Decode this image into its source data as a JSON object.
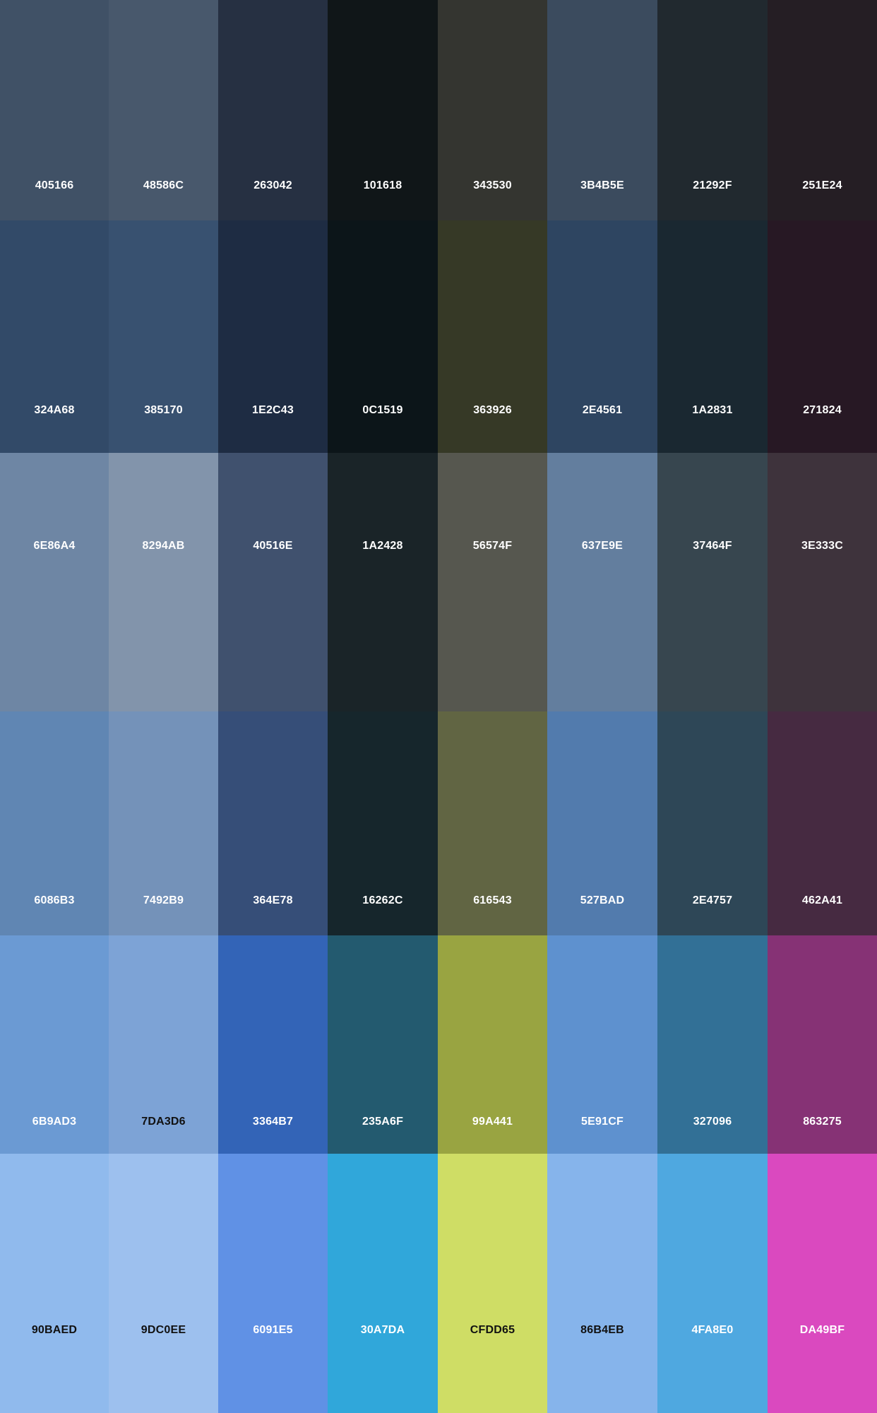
{
  "palette": {
    "rows": [
      [
        {
          "hex": "405166",
          "color": "#405166"
        },
        {
          "hex": "48586C",
          "color": "#48586C"
        },
        {
          "hex": "263042",
          "color": "#263042"
        },
        {
          "hex": "101618",
          "color": "#101618"
        },
        {
          "hex": "343530",
          "color": "#343530"
        },
        {
          "hex": "3B4B5E",
          "color": "#3B4B5E"
        },
        {
          "hex": "21292F",
          "color": "#21292F"
        },
        {
          "hex": "251E24",
          "color": "#251E24"
        }
      ],
      [
        {
          "hex": "324A68",
          "color": "#324A68"
        },
        {
          "hex": "385170",
          "color": "#385170"
        },
        {
          "hex": "1E2C43",
          "color": "#1E2C43"
        },
        {
          "hex": "0C1519",
          "color": "#0C1519"
        },
        {
          "hex": "363926",
          "color": "#363926"
        },
        {
          "hex": "2E4561",
          "color": "#2E4561"
        },
        {
          "hex": "1A2831",
          "color": "#1A2831"
        },
        {
          "hex": "271824",
          "color": "#271824"
        }
      ],
      [
        {
          "hex": "6E86A4",
          "color": "#6E86A4"
        },
        {
          "hex": "8294AB",
          "color": "#8294AB"
        },
        {
          "hex": "40516E",
          "color": "#40516E"
        },
        {
          "hex": "1A2428",
          "color": "#1A2428"
        },
        {
          "hex": "56574F",
          "color": "#56574F"
        },
        {
          "hex": "637E9E",
          "color": "#637E9E"
        },
        {
          "hex": "37464F",
          "color": "#37464F"
        },
        {
          "hex": "3E333C",
          "color": "#3E333C"
        }
      ],
      [
        {
          "hex": "6086B3",
          "color": "#6086B3"
        },
        {
          "hex": "7492B9",
          "color": "#7492B9"
        },
        {
          "hex": "364E78",
          "color": "#364E78"
        },
        {
          "hex": "16262C",
          "color": "#16262C"
        },
        {
          "hex": "616543",
          "color": "#616543"
        },
        {
          "hex": "527BAD",
          "color": "#527BAD"
        },
        {
          "hex": "2E4757",
          "color": "#2E4757"
        },
        {
          "hex": "462A41",
          "color": "#462A41"
        }
      ],
      [
        {
          "hex": "6B9AD3",
          "color": "#6B9AD3"
        },
        {
          "hex": "7DA3D6",
          "color": "#7DA3D6"
        },
        {
          "hex": "3364B7",
          "color": "#3364B7"
        },
        {
          "hex": "235A6F",
          "color": "#235A6F"
        },
        {
          "hex": "99A441",
          "color": "#99A441"
        },
        {
          "hex": "5E91CF",
          "color": "#5E91CF"
        },
        {
          "hex": "327096",
          "color": "#327096"
        },
        {
          "hex": "863275",
          "color": "#863275"
        }
      ],
      [
        {
          "hex": "90BAED",
          "color": "#90BAED"
        },
        {
          "hex": "9DC0EE",
          "color": "#9DC0EE"
        },
        {
          "hex": "6091E5",
          "color": "#6091E5"
        },
        {
          "hex": "30A7DA",
          "color": "#30A7DA"
        },
        {
          "hex": "CFDD65",
          "color": "#CFDD65"
        },
        {
          "hex": "86B4EB",
          "color": "#86B4EB"
        },
        {
          "hex": "4FA8E0",
          "color": "#4FA8E0"
        },
        {
          "hex": "DA49BF",
          "color": "#DA49BF"
        }
      ]
    ],
    "label_colors": {
      "light": "#FFFFFF",
      "dark": "#111111"
    }
  }
}
